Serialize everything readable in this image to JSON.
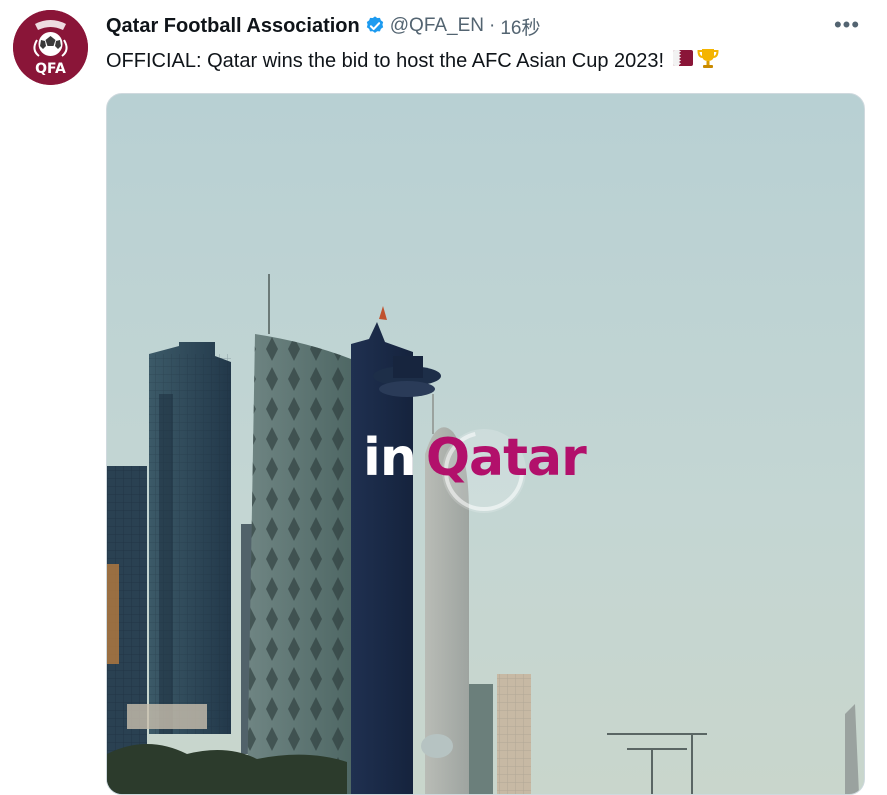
{
  "tweet": {
    "author_name": "Qatar Football Association",
    "author_handle": "@QFA_EN",
    "separator": "·",
    "timestamp": "16秒",
    "avatar_text": "QFA",
    "more_glyph": "•••",
    "text": "OFFICIAL: Qatar wins the bid to host the AFC Asian Cup 2023!",
    "emojis": [
      "qatar-flag",
      "trophy"
    ],
    "verified": true
  },
  "media": {
    "overlay_word_1": "in",
    "overlay_word_2": "Qatar"
  },
  "colors": {
    "brand_maroon": "#8a1538",
    "verified_blue": "#1d9bf0",
    "overlay_magenta": "#b2106b",
    "sky": "#bfd4d5",
    "text_primary": "#0f1419",
    "text_secondary": "#536471"
  }
}
